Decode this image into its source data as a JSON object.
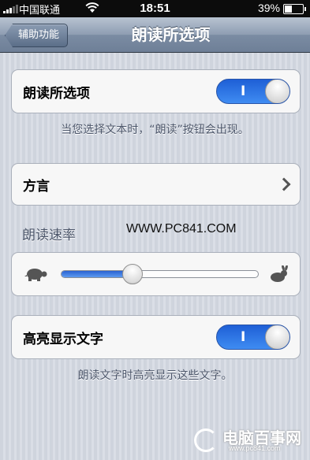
{
  "status_bar": {
    "carrier": "中国联通",
    "time": "18:51",
    "battery": "39%",
    "battery_level": 0.39
  },
  "nav": {
    "back_label": "辅助功能",
    "title": "朗读所选项"
  },
  "speak_selection": {
    "label": "朗读所选项",
    "toggle_text": "I",
    "enabled": true,
    "footnote": "当您选择文本时，“朗读”按钮会出现。"
  },
  "dialect": {
    "label": "方言"
  },
  "speaking_rate": {
    "header": "朗读速率",
    "value": 0.36
  },
  "watermark": "WWW.PC841.COM",
  "highlight_words": {
    "label": "高亮显示文字",
    "toggle_text": "I",
    "enabled": true,
    "footnote": "朗读文字时高亮显示这些文字。"
  },
  "logo": {
    "name": "电脑百事网",
    "url": "www.pc841.com"
  },
  "colors": {
    "toggle_on": "#2f74e6",
    "navbar": "#8e9db2"
  },
  "icons": {
    "slow": "turtle-icon",
    "fast": "rabbit-icon",
    "disclosure": "chevron-right-icon"
  }
}
